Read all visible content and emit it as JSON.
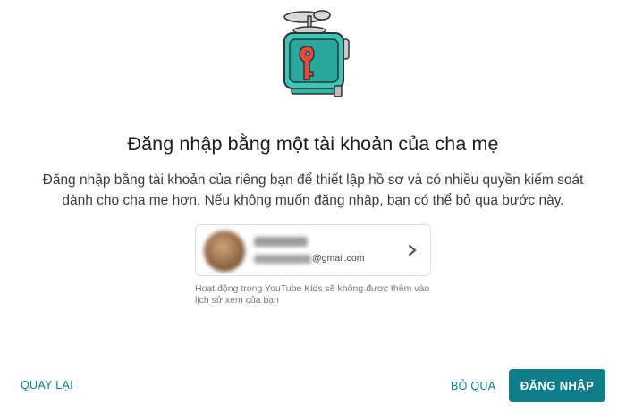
{
  "header": {
    "title": "Đăng nhập bằng một tài khoản của cha mẹ",
    "description": "Đăng nhập bằng tài khoản của riêng bạn để thiết lập hồ sơ và có nhiều quyền kiếm soát dành cho cha mẹ hơn. Nếu không muốn đăng nhập, bạn có thể bỏ qua bước này."
  },
  "account": {
    "email_domain": "@gmail.com",
    "note": "Hoạt động trong YouTube Kids sẽ không được thêm vào lịch sử xem của bạn"
  },
  "footer": {
    "back_label": "QUAY LẠI",
    "skip_label": "BỎ QUA",
    "signin_label": "ĐĂNG NHẬP"
  },
  "colors": {
    "accent": "#0f7d8a",
    "link": "#0b7f8c"
  },
  "icons": {
    "hero": "helicopter-tv-key-illustration",
    "chevron": "chevron-right-icon"
  }
}
